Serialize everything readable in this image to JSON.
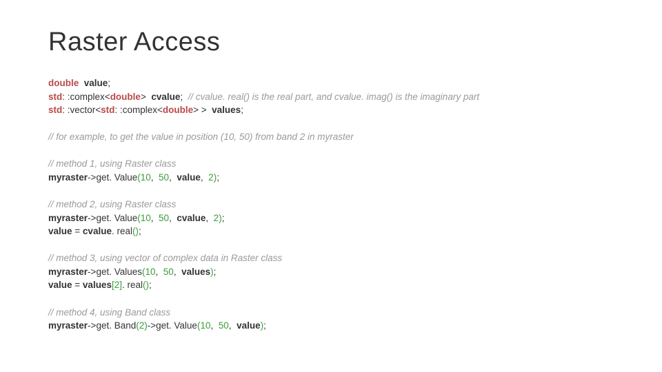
{
  "title": "Raster Access",
  "tokens": {
    "double": "double",
    "std": "std",
    "complex": "complex",
    "vector": "vector",
    "value": "value",
    "cvalue": "cvalue",
    "values": "values",
    "myraster": "myraster",
    "getValue": "get. Value",
    "getValues": "get. Values",
    "getBand": "get. Band",
    "real": "real",
    "lt": "<",
    "gt": ">",
    "gtspace": " >",
    "scope": ": :",
    "arrow": "->",
    "eq": " = ",
    "lparen": "(",
    "rparen": ")",
    "lbrack": "[",
    "rbrack": "]",
    "semi": ";",
    "comma": ", ",
    "dot": ". ",
    "n10": "10",
    "n50": "50",
    "n2": "2"
  },
  "comments": {
    "c1": "// cvalue. real() is the real part, and cvalue. imag() is the imaginary part",
    "c2": "// for example, to get the value in position (10, 50) from band 2 in myraster",
    "c3": "// method 1, using Raster class",
    "c4": "// method 2, using Raster class",
    "c5": "// method 3, using vector of complex data in Raster class",
    "c6": "// method 4, using Band class"
  }
}
